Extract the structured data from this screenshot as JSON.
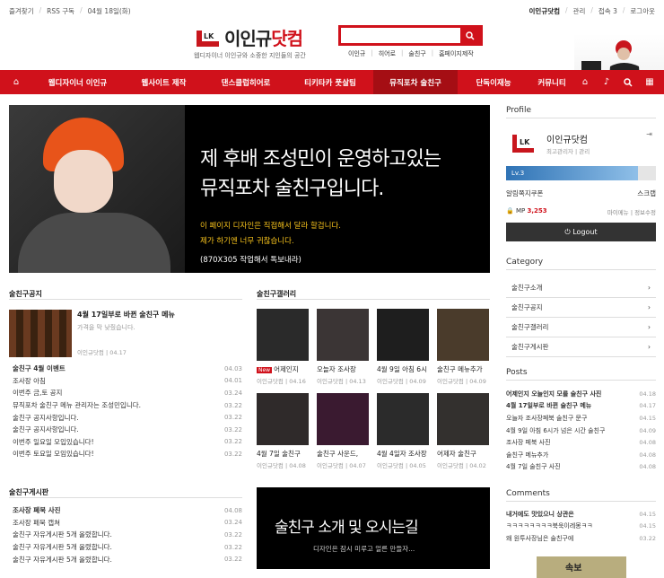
{
  "topbar": {
    "left": [
      "즐겨찾기",
      "RSS 구독",
      "04월 18일(화)"
    ],
    "right": [
      "이인규닷컴",
      "관리",
      "접속 3",
      "로그아웃"
    ]
  },
  "header": {
    "logo_prefix": "이인규",
    "logo_suffix": "닷컴",
    "tagline": "웹디자이너 이인규와 소중한 지인들의 공간",
    "search_placeholder": "",
    "quicklinks": [
      "이인규",
      "히어로",
      "술친구",
      "홈페이지제작"
    ]
  },
  "nav": {
    "items": [
      "웹디자이너 이인규",
      "웹사이트 제작",
      "댄스클럽히어로",
      "티키타카 풋살팀",
      "뮤직포차 술친구",
      "단독이재능",
      "커뮤니티"
    ],
    "active_index": 4
  },
  "banner": {
    "line1": "제 후배 조성민이 운영하고있는",
    "line2": "뮤직포차 술친구입니다.",
    "note1": "이 페이지 디자인은 직접해서 달라 할겁니다.",
    "note2": "제가 하기엔 너무 귀찮습니다.",
    "size": "(870X305 작업해서 톡보내라)"
  },
  "notice": {
    "title": "술친구공지",
    "feature": {
      "title": "4월 17일부로 바뀐 술친구 메뉴",
      "summary": "가격을 막 낮췄습니다.",
      "author": "이인규닷컴",
      "date": "04.17"
    },
    "items": [
      {
        "t": "술친구 4월 이벤트",
        "d": "04.03",
        "b": true
      },
      {
        "t": "조사장 아침",
        "d": "04.01",
        "b": false
      },
      {
        "t": "이번주 금,토 공지",
        "d": "03.24",
        "b": false
      },
      {
        "t": "뮤직포차 술친구 메뉴 관리자는 조성민입니다.",
        "d": "03.22",
        "b": false
      },
      {
        "t": "술친구 공지사항입니다.",
        "d": "03.22",
        "b": false
      },
      {
        "t": "술친구 공지사항입니다.",
        "d": "03.22",
        "b": false
      },
      {
        "t": "이번주 일요일 모입있습니다!",
        "d": "03.22",
        "b": false
      },
      {
        "t": "이번주 토요일 모임있습니다!",
        "d": "03.22",
        "b": false
      }
    ]
  },
  "gallery": {
    "title": "술친구갤러리",
    "items": [
      {
        "t": "어제인지",
        "m": "이인규닷컴  |  04.16",
        "new": true
      },
      {
        "t": "오늘자 조사장",
        "m": "이인규닷컴  |  04.13",
        "new": false
      },
      {
        "t": "4월 9일 아침 6시",
        "m": "이인규닷컴  |  04.09",
        "new": false
      },
      {
        "t": "술친구 메뉴추가",
        "m": "이인규닷컴  |  04.09",
        "new": false
      },
      {
        "t": "4월 7일 술친구",
        "m": "이인규닷컴  |  04.08",
        "new": false
      },
      {
        "t": "술친구 사운드,",
        "m": "이인규닷컴  |  04.07",
        "new": false
      },
      {
        "t": "4월 4일자 조사장",
        "m": "이인규닷컴  |  04.05",
        "new": false
      },
      {
        "t": "어제자 술친구",
        "m": "이인규닷컴  |  04.02",
        "new": false
      }
    ]
  },
  "board": {
    "title": "술친구게시판",
    "items": [
      {
        "t": "조사장 폐북 사진",
        "d": "04.08",
        "b": true
      },
      {
        "t": "조사장 페북 캡쳐",
        "d": "03.24",
        "b": false
      },
      {
        "t": "술친구 자유게시판 5개 올렸합니다.",
        "d": "03.22",
        "b": false
      },
      {
        "t": "술친구 자유게시판 5개 올렸합니다.",
        "d": "03.22",
        "b": false
      },
      {
        "t": "술친구 자유게시판 5개 올렸합니다.",
        "d": "03.22",
        "b": false
      }
    ]
  },
  "promo": {
    "title": "술친구 소개 및 오시는길",
    "sub": "디자인은 잠시 미루고 얼른 만들자..."
  },
  "profile": {
    "title": "Profile",
    "name": "이인규닷컴",
    "role": "최고관리자  |  관리",
    "level": "Lv.3",
    "links": [
      "알림",
      "쪽지",
      "쿠폰",
      "스크랩"
    ],
    "mp_label": "MP",
    "mp_value": "3,253",
    "right_links": "마이메뉴  |  정보수정",
    "logout": "Logout"
  },
  "category": {
    "title": "Category",
    "items": [
      "술친구소개",
      "술친구공지",
      "술친구갤러리",
      "술친구게시판"
    ]
  },
  "posts": {
    "title": "Posts",
    "items": [
      {
        "t": "어제인지 오늘인지 모를 술친구 사진",
        "d": "04.18",
        "b": true
      },
      {
        "t": "4월 17일부로 바뀐 술친구 메뉴",
        "d": "04.17",
        "b": true
      },
      {
        "t": "오늘자 조사장페북 술친구 문구",
        "d": "04.15",
        "b": false
      },
      {
        "t": "4월 9일 아침 6시가 넘은 시간 술친구",
        "d": "04.09",
        "b": false
      },
      {
        "t": "조사장 페북 사진",
        "d": "04.08",
        "b": false
      },
      {
        "t": "술친구 메뉴추가",
        "d": "04.08",
        "b": false
      },
      {
        "t": "4월 7일 술친구 사진",
        "d": "04.08",
        "b": false
      }
    ]
  },
  "comments": {
    "title": "Comments",
    "items": [
      {
        "t": "내거에도 맛있으니 상관은",
        "d": "04.15",
        "b": true
      },
      {
        "t": "ㅋㅋㅋㅋㅋㅋㅋㅋ북욱이레몽ㅋㅋ",
        "d": "04.15",
        "b": false
      },
      {
        "t": "왜 원투사장님은 술친구에",
        "d": "03.22",
        "b": false
      }
    ]
  },
  "ad": {
    "title": "속보"
  },
  "colors": {
    "accent": "#d0111b",
    "nav_active": "#a50e14",
    "banner_note": "#f6c21c"
  }
}
